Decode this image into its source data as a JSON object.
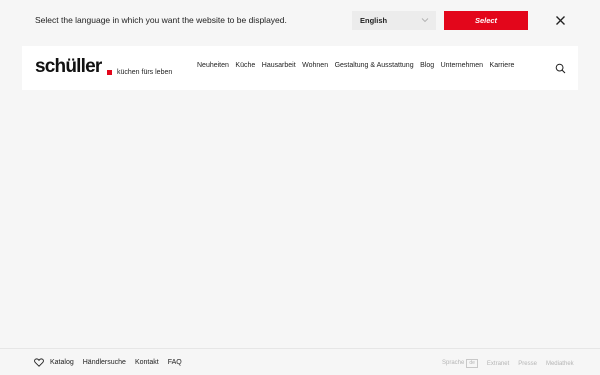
{
  "language_bar": {
    "prompt": "Select the language in which you want the website to be displayed.",
    "selected_language": "English",
    "select_label": "Select"
  },
  "header": {
    "logo": "schüller",
    "tagline": "küchen fürs leben",
    "nav": [
      "Neuheiten",
      "Küche",
      "Hausarbeit",
      "Wohnen",
      "Gestaltung & Ausstattung",
      "Blog",
      "Unternehmen",
      "Karriere"
    ]
  },
  "footer": {
    "links": [
      "Katalog",
      "Händlersuche",
      "Kontakt",
      "FAQ"
    ],
    "sprache_label": "Sprache",
    "sprache_code": "de",
    "right_links": [
      "Extranet",
      "Presse",
      "Mediathek"
    ]
  },
  "colors": {
    "accent": "#e3061b",
    "background": "#f6f6f6"
  }
}
